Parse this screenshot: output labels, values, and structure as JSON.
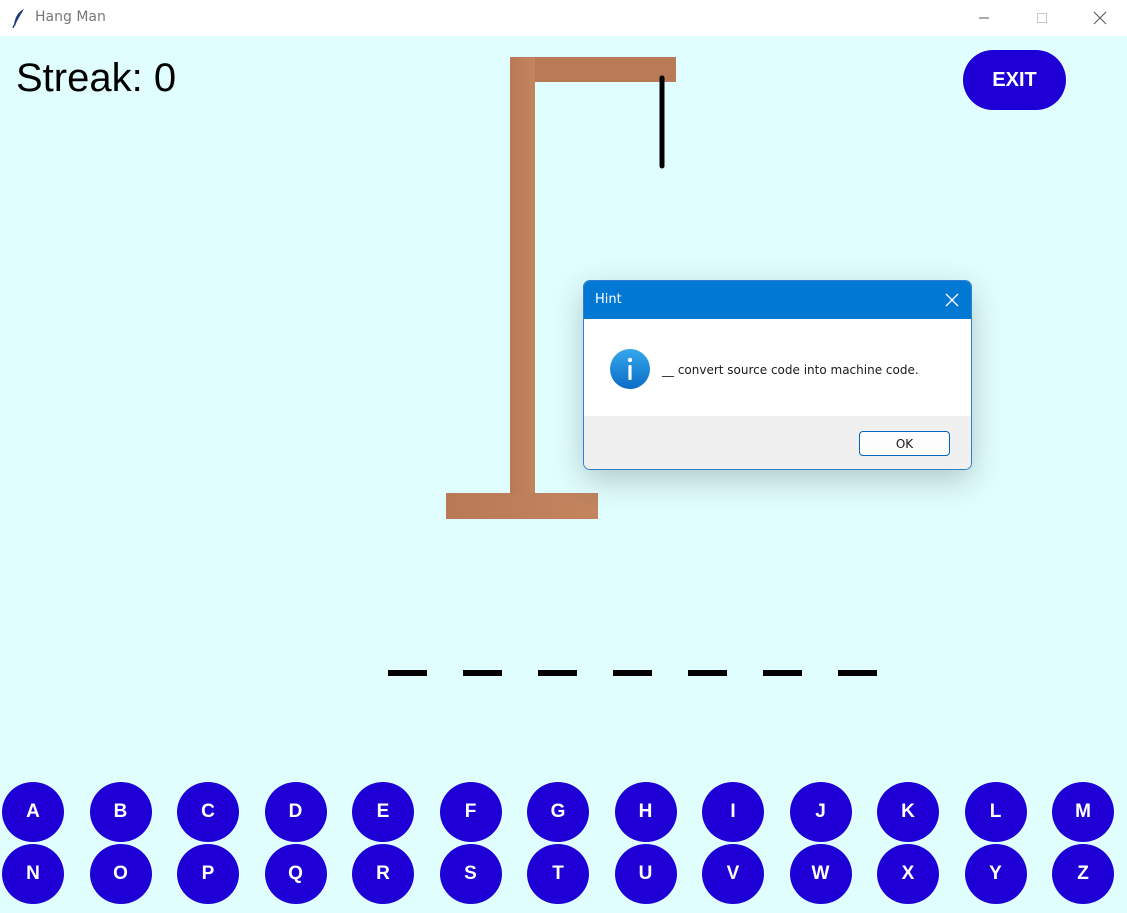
{
  "window": {
    "title": "Hang Man",
    "app_icon": "feather-icon",
    "controls": [
      "minimize-icon",
      "maximize-icon",
      "close-icon"
    ]
  },
  "game": {
    "streak_text": "Streak: 0",
    "exit_label": "EXIT",
    "wrong_guesses": 0,
    "blank_count": 7,
    "letters_row1": [
      "A",
      "B",
      "C",
      "D",
      "E",
      "F",
      "G",
      "H",
      "I",
      "J",
      "K",
      "L",
      "M"
    ],
    "letters_row2": [
      "N",
      "O",
      "P",
      "Q",
      "R",
      "S",
      "T",
      "U",
      "V",
      "W",
      "X",
      "Y",
      "Z"
    ]
  },
  "hint_dialog": {
    "title": "Hint",
    "icon": "info-icon",
    "message": "__ convert source code into machine code.",
    "ok_label": "OK"
  },
  "colors": {
    "canvas_bg": "#e1fefe",
    "button_blue": "#1e00d6",
    "gallows_brown": "#b97a57",
    "dialog_header": "#0078d4"
  }
}
